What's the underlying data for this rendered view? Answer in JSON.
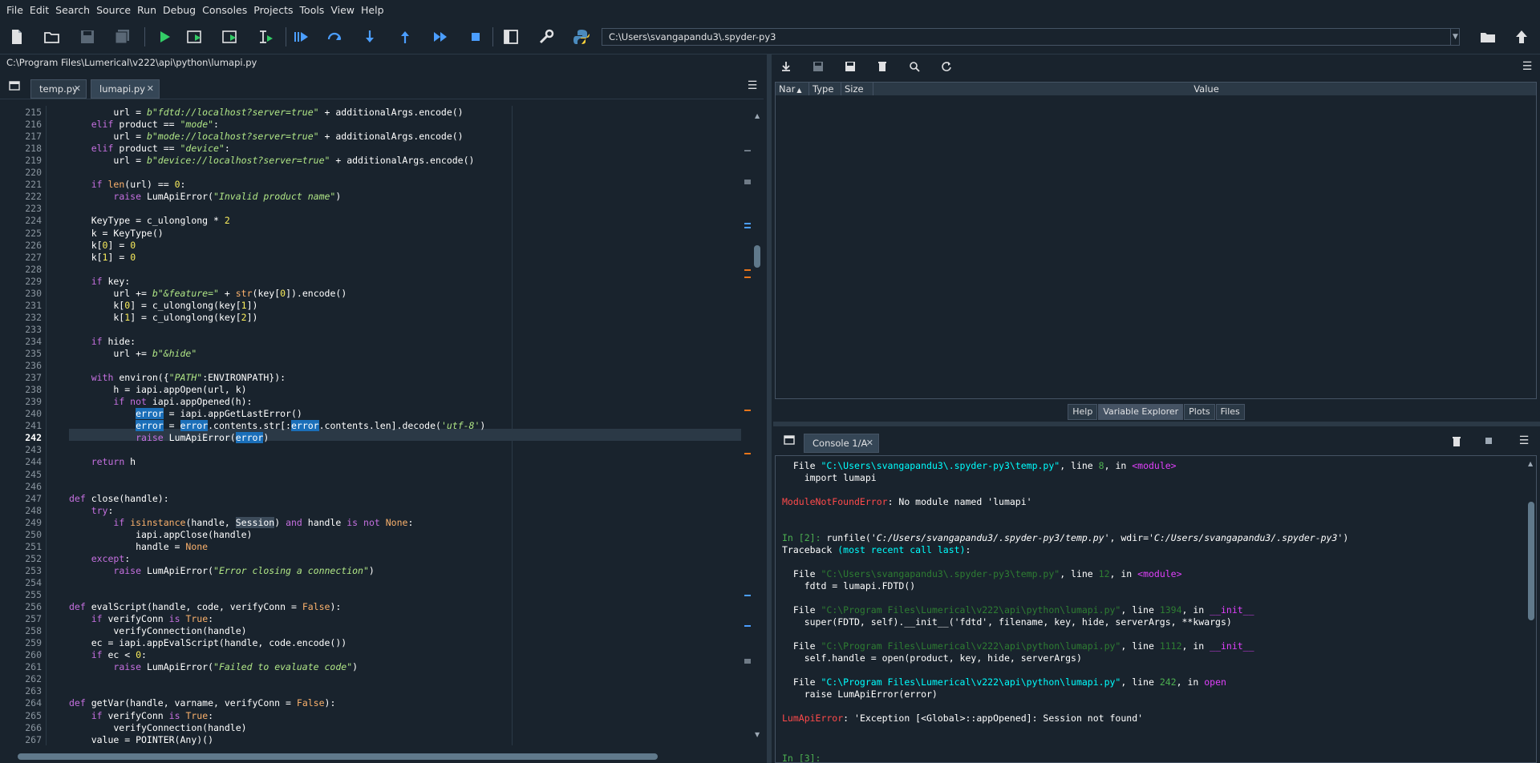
{
  "menubar": [
    "File",
    "Edit",
    "Search",
    "Source",
    "Run",
    "Debug",
    "Consoles",
    "Projects",
    "Tools",
    "View",
    "Help"
  ],
  "toolbar": {
    "working_dir": "C:\\Users\\svangapandu3\\.spyder-py3"
  },
  "editor": {
    "path": "C:\\Program Files\\Lumerical\\v222\\api\\python\\lumapi.py",
    "tabs": [
      {
        "label": "temp.py",
        "active": false
      },
      {
        "label": "lumapi.py",
        "active": true
      }
    ],
    "current_line": 242,
    "first_line": 215
  },
  "variable_explorer": {
    "columns": [
      "Nar",
      "Type",
      "Size",
      "Value"
    ]
  },
  "pane_tabs": [
    {
      "label": "Help",
      "active": false
    },
    {
      "label": "Variable Explorer",
      "active": true
    },
    {
      "label": "Plots",
      "active": false
    },
    {
      "label": "Files",
      "active": false
    }
  ],
  "console": {
    "tab_label": "Console 1/A"
  },
  "colors": {
    "bg": "#19232d",
    "panel": "#2b3946",
    "accent": "#1b6fb9"
  }
}
